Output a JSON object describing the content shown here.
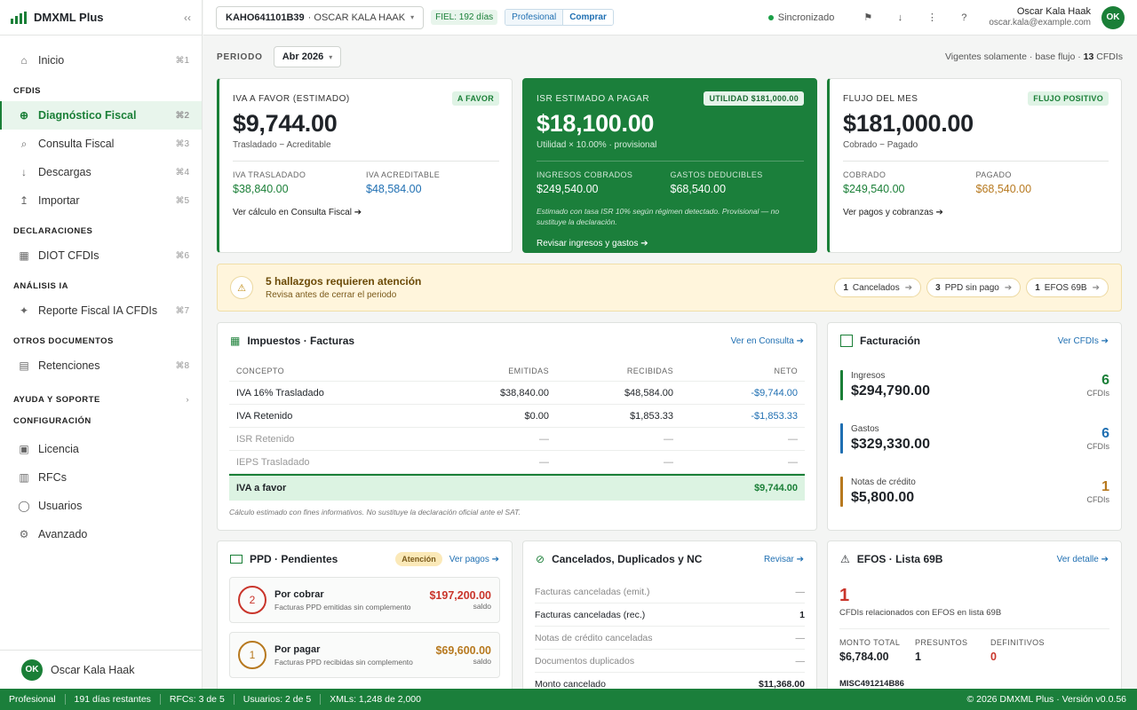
{
  "app": {
    "name": "DMXML Plus",
    "collapse_icon": "‹‹"
  },
  "nav": {
    "home": {
      "label": "Inicio",
      "kbd": "⌘1"
    },
    "sections": {
      "cfdis": "CFDIS",
      "declaraciones": "DECLARACIONES",
      "analisis": "ANÁLISIS IA",
      "otros": "OTROS DOCUMENTOS",
      "ayuda": "AYUDA Y SOPORTE",
      "config": "CONFIGURACIÓN"
    },
    "items": {
      "diagnostico": {
        "label": "Diagnóstico Fiscal",
        "kbd": "⌘2"
      },
      "consulta": {
        "label": "Consulta Fiscal",
        "kbd": "⌘3"
      },
      "descargas": {
        "label": "Descargas",
        "kbd": "⌘4"
      },
      "importar": {
        "label": "Importar",
        "kbd": "⌘5"
      },
      "diot": {
        "label": "DIOT CFDIs",
        "kbd": "⌘6"
      },
      "reporte": {
        "label": "Reporte Fiscal IA CFDIs",
        "kbd": "⌘7"
      },
      "retenciones": {
        "label": "Retenciones",
        "kbd": "⌘8"
      },
      "licencia": {
        "label": "Licencia"
      },
      "rfcs": {
        "label": "RFCs"
      },
      "usuarios": {
        "label": "Usuarios"
      },
      "avanzado": {
        "label": "Avanzado"
      }
    }
  },
  "user": {
    "initials": "OK",
    "name": "Oscar Kala Haak",
    "email": "oscar.kala@example.com"
  },
  "topbar": {
    "rfc": "KAHO641101B39",
    "rfc_name": "· OSCAR KALA HAAK",
    "fiel": "FIEL: 192 días",
    "plan": "Profesional",
    "buy": "Comprar",
    "sync": "Sincronizado"
  },
  "periodo": {
    "label": "PERIODO",
    "value": "Abr 2026"
  },
  "vigentes": {
    "text": "Vigentes solamente · base flujo ·",
    "count": "13",
    "unit": "CFDIs"
  },
  "kpis": {
    "iva": {
      "title": "IVA A FAVOR (ESTIMADO)",
      "pill": "A FAVOR",
      "value": "$9,744.00",
      "sub": "Trasladado − Acreditable",
      "l1": "IVA TRASLADADO",
      "v1": "$38,840.00",
      "l2": "IVA ACREDITABLE",
      "v2": "$48,584.00",
      "link": "Ver cálculo en Consulta Fiscal ➔"
    },
    "isr": {
      "title": "ISR ESTIMADO A PAGAR",
      "pill": "UTILIDAD $181,000.00",
      "value": "$18,100.00",
      "sub": "Utilidad × 10.00% · provisional",
      "l1": "INGRESOS COBRADOS",
      "v1": "$249,540.00",
      "l2": "GASTOS DEDUCIBLES",
      "v2": "$68,540.00",
      "note": "Estimado con tasa ISR 10% según régimen detectado. Provisional — no sustituye la declaración.",
      "link": "Revisar ingresos y gastos ➔"
    },
    "flujo": {
      "title": "FLUJO DEL MES",
      "pill": "FLUJO POSITIVO",
      "value": "$181,000.00",
      "sub": "Cobrado − Pagado",
      "l1": "COBRADO",
      "v1": "$249,540.00",
      "l2": "PAGADO",
      "v2": "$68,540.00",
      "link": "Ver pagos y cobranzas ➔"
    }
  },
  "alert": {
    "title": "5 hallazgos requieren atención",
    "sub": "Revisa antes de cerrar el periodo",
    "chips": [
      {
        "n": "1",
        "label": "Cancelados"
      },
      {
        "n": "3",
        "label": "PPD sin pago"
      },
      {
        "n": "1",
        "label": "EFOS 69B"
      }
    ]
  },
  "impuestos": {
    "title": "Impuestos · Facturas",
    "link": "Ver en Consulta ➔",
    "headers": [
      "CONCEPTO",
      "EMITIDAS",
      "RECIBIDAS",
      "NETO"
    ],
    "rows": [
      [
        "IVA 16% Trasladado",
        "$38,840.00",
        "$48,584.00",
        "-$9,744.00"
      ],
      [
        "IVA Retenido",
        "$0.00",
        "$1,853.33",
        "-$1,853.33"
      ],
      [
        "ISR Retenido",
        "—",
        "—",
        "—"
      ],
      [
        "IEPS Trasladado",
        "—",
        "—",
        "—"
      ]
    ],
    "total_label": "IVA a favor",
    "total_value": "$9,744.00",
    "footnote": "Cálculo estimado con fines informativos. No sustituye la declaración oficial ante el SAT."
  },
  "facturacion": {
    "title": "Facturación",
    "link": "Ver CFDIs ➔",
    "unit": "CFDIs",
    "rows": [
      {
        "label": "Ingresos",
        "value": "$294,790.00",
        "count": "6",
        "color": "#1a7f37"
      },
      {
        "label": "Gastos",
        "value": "$329,330.00",
        "count": "6",
        "color": "#1f6fb2"
      },
      {
        "label": "Notas de crédito",
        "value": "$5,800.00",
        "count": "1",
        "color": "#b7791f"
      }
    ]
  },
  "ppd": {
    "title": "PPD · Pendientes",
    "pill": "Atención",
    "link": "Ver pagos ➔",
    "saldo": "saldo",
    "cobrar": {
      "n": "2",
      "title": "Por cobrar",
      "sub": "Facturas PPD emitidas sin complemento",
      "value": "$197,200.00"
    },
    "pagar": {
      "n": "1",
      "title": "Por pagar",
      "sub": "Facturas PPD recibidas sin complemento",
      "value": "$69,600.00"
    }
  },
  "cancelados": {
    "title": "Cancelados, Duplicados y NC",
    "link": "Revisar ➔",
    "rows": [
      {
        "label": "Facturas canceladas (emit.)",
        "value": "—"
      },
      {
        "label": "Facturas canceladas (rec.)",
        "value": "1"
      },
      {
        "label": "Notas de crédito canceladas",
        "value": "—"
      },
      {
        "label": "Documentos duplicados",
        "value": "—"
      },
      {
        "label": "Monto cancelado",
        "value": "$11,368.00"
      }
    ]
  },
  "efos": {
    "title": "EFOS · Lista 69B",
    "link": "Ver detalle ➔",
    "count": "1",
    "sub": "CFDIs relacionados con EFOS en lista 69B",
    "l1": "MONTO TOTAL",
    "v1": "$6,784.00",
    "l2": "PRESUNTOS",
    "v2": "1",
    "l3": "DEFINITIVOS",
    "v3": "0",
    "rfc": "MISC491214B86"
  },
  "statusbar": {
    "plan": "Profesional",
    "dias": "191 días restantes",
    "rfcs": "RFCs: 3 de 5",
    "usuarios": "Usuarios: 2 de 5",
    "xmls": "XMLs: 1,248 de 2,000",
    "copy": "© 2026 DMXML Plus · Versión v0.0.56"
  }
}
